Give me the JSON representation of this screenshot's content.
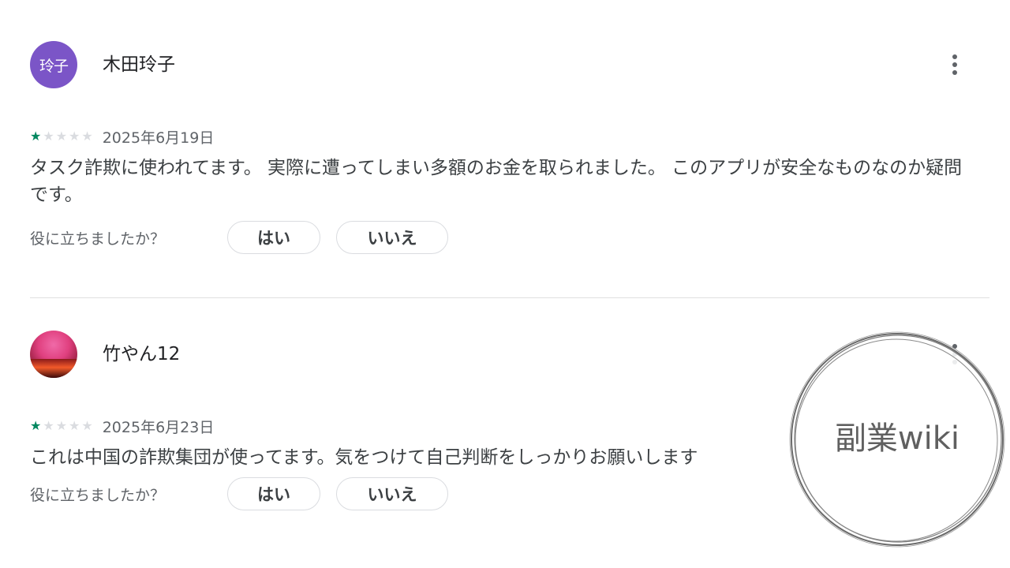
{
  "reviews": [
    {
      "avatar_text": "玲子",
      "author": "木田玲子",
      "rating": 1,
      "max_rating": 5,
      "date": "2025年6月19日",
      "text": "タスク詐欺に使われてます。 実際に遭ってしまい多額のお金を取られました。 このアプリが安全なものなのか疑問です。",
      "helpful_question": "役に立ちましたか？",
      "yes_label": "はい",
      "no_label": "いいえ"
    },
    {
      "avatar_text": "",
      "author": "竹やん12",
      "rating": 1,
      "max_rating": 5,
      "date": "2025年6月23日",
      "text": "これは中国の詐欺集団が使ってます。気をつけて自己判断をしっかりお願いします",
      "helpful_question": "役に立ちましたか？",
      "yes_label": "はい",
      "no_label": "いいえ"
    }
  ],
  "watermark": {
    "text": "副業wiki"
  },
  "colors": {
    "star_filled": "#01875f",
    "star_empty": "#dadce0",
    "avatar_purple": "#7b55c7"
  },
  "icons": {
    "more": "more-vert-icon",
    "star": "star-icon"
  }
}
